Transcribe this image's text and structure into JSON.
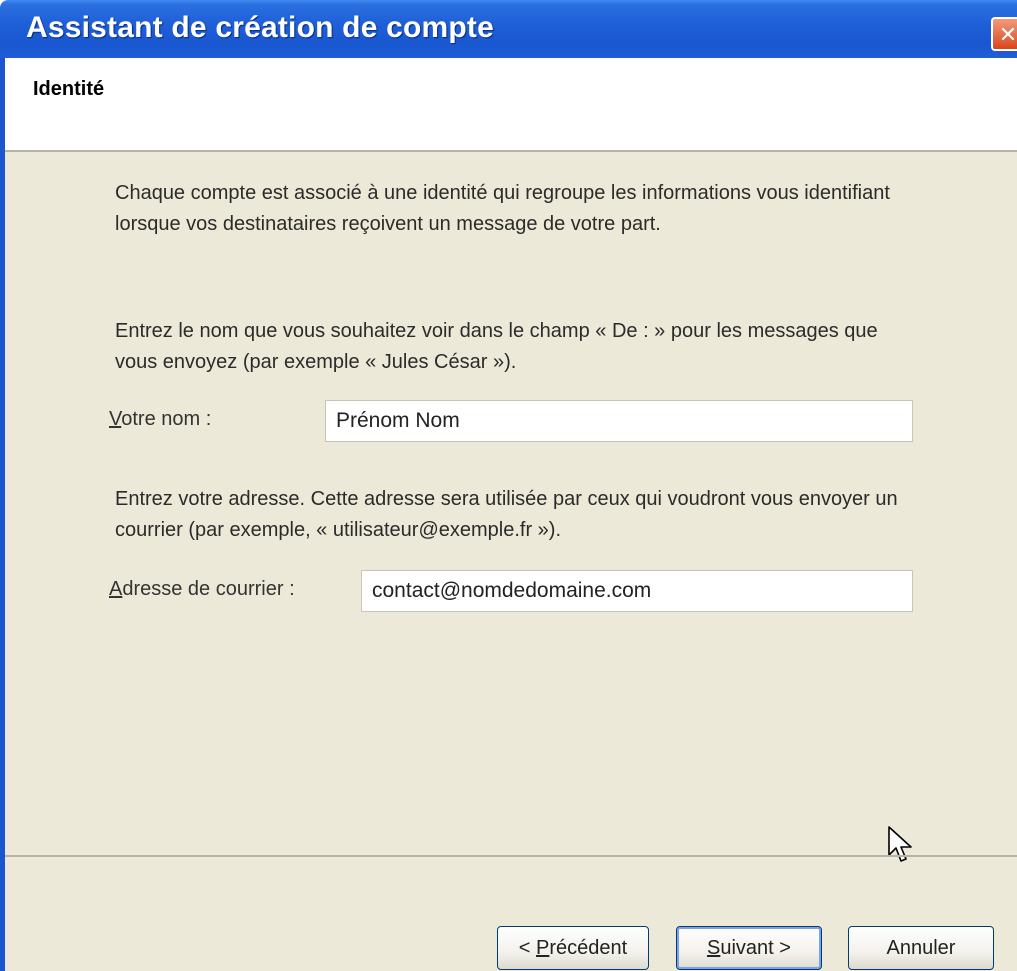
{
  "window": {
    "title": "Assistant de création de compte",
    "close_glyph": "✕"
  },
  "header": {
    "title": "Identité"
  },
  "content": {
    "intro": "Chaque compte est associé à une identité qui regroupe les informations vous identifiant lorsque vos destinataires reçoivent un message de votre part.",
    "name_instructions": "Entrez le nom que vous souhaitez voir dans le champ « De : » pour les messages que vous envoyez (par exemple « Jules César »).",
    "name_label_accel": "V",
    "name_label_rest": "otre nom :",
    "name_value": "Prénom Nom",
    "email_instructions": "Entrez votre adresse. Cette adresse sera utilisée par ceux qui voudront vous envoyer un courrier (par exemple, « utilisateur@exemple.fr »).",
    "email_label_accel": "A",
    "email_label_rest": "dresse de courrier :",
    "email_value": "contact@nomdedomaine.com"
  },
  "buttons": {
    "prev_prefix": "< ",
    "prev_accel": "P",
    "prev_rest": "récédent",
    "next_accel": "S",
    "next_rest": "uivant >",
    "cancel": "Annuler"
  },
  "icons": {
    "close": "close-icon",
    "cursor": "mouse-cursor-icon"
  },
  "colors": {
    "titlebar": "#1f60d8",
    "dialog_bg": "#ece9d8",
    "button_border": "#003c74",
    "close_button": "#d8461c"
  }
}
